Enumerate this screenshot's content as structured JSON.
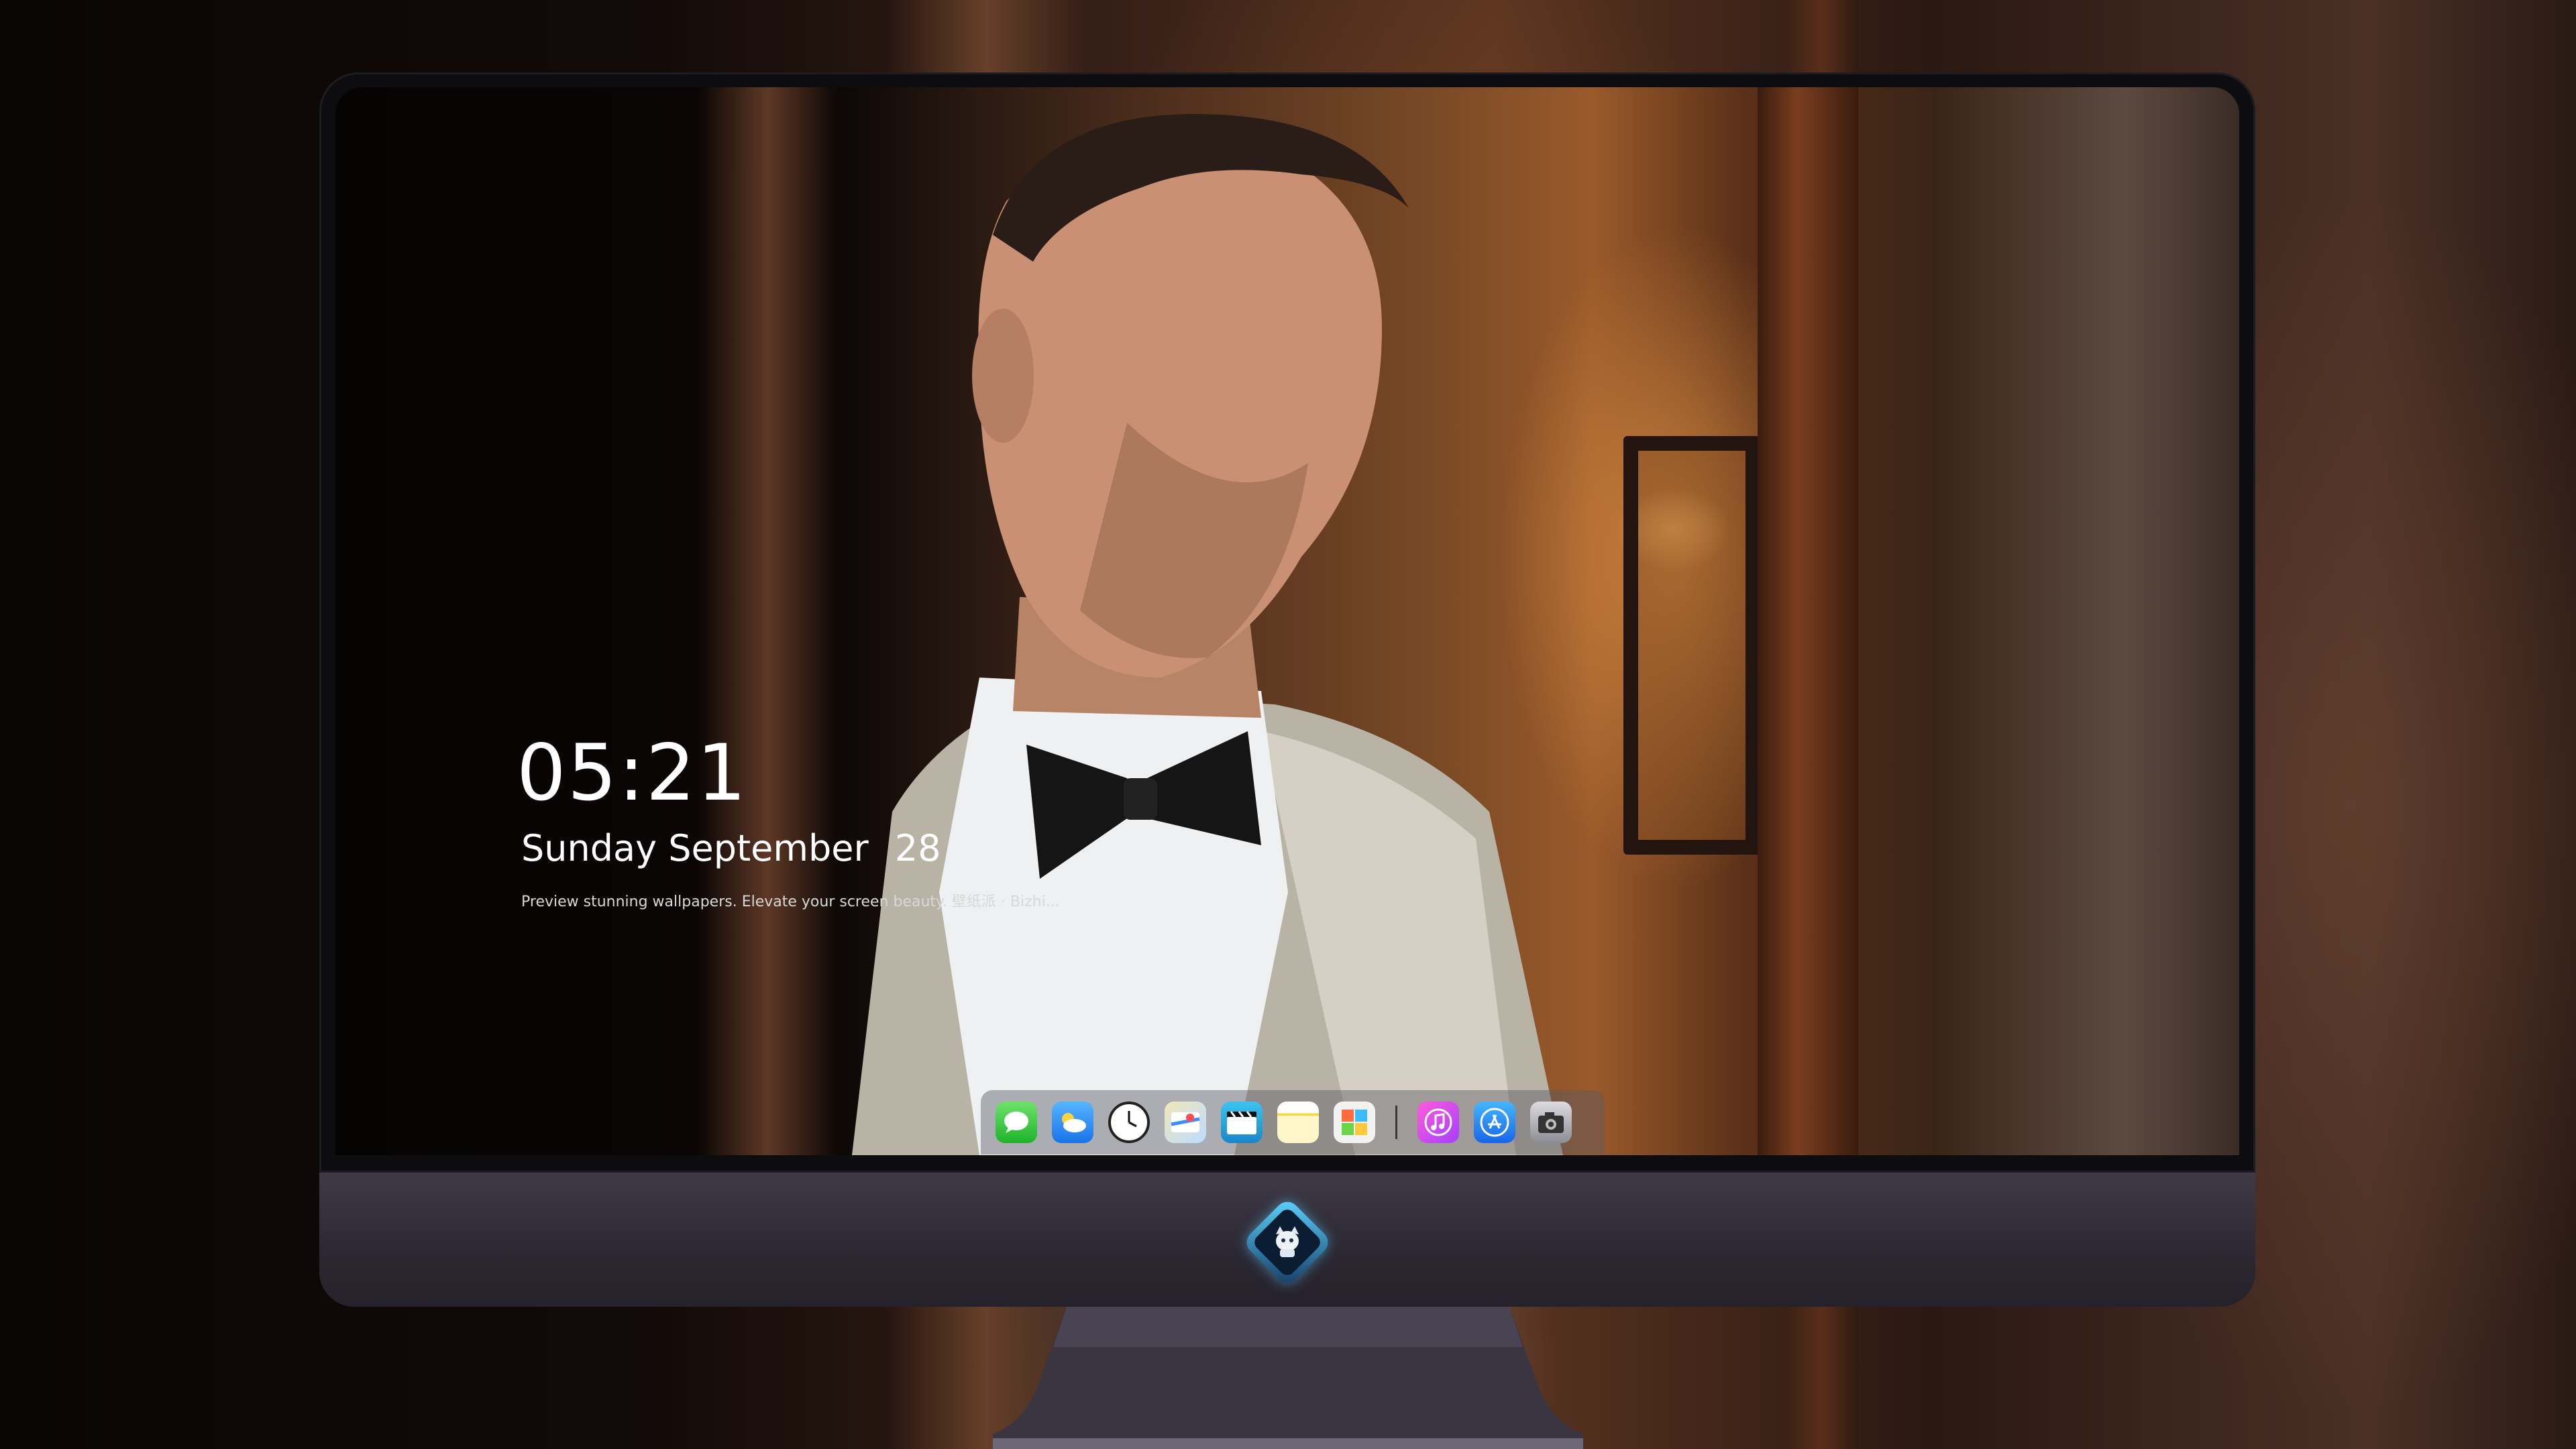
{
  "lock_screen": {
    "time": "05:21",
    "weekday": "Sunday",
    "month": "September",
    "day": "28",
    "tagline": "Preview stunning wallpapers. Elevate your screen beauty. 壁纸派 · Bizhi..."
  },
  "dock": {
    "apps": [
      {
        "name": "Messages",
        "icon": "messages-icon"
      },
      {
        "name": "Weather",
        "icon": "weather-icon"
      },
      {
        "name": "Clock",
        "icon": "clock-icon"
      },
      {
        "name": "Maps",
        "icon": "maps-icon"
      },
      {
        "name": "Videos",
        "icon": "videos-icon"
      },
      {
        "name": "Notes",
        "icon": "notes-icon"
      },
      {
        "name": "Photos",
        "icon": "photos-icon"
      },
      {
        "name": "Music",
        "icon": "music-icon"
      },
      {
        "name": "App Store",
        "icon": "app-store-icon"
      },
      {
        "name": "Camera",
        "icon": "camera-icon"
      }
    ]
  },
  "colors": {
    "text": "#ffffff",
    "dock_bg": "rgba(90,90,100,0.45)",
    "chin": "#2c2832"
  }
}
